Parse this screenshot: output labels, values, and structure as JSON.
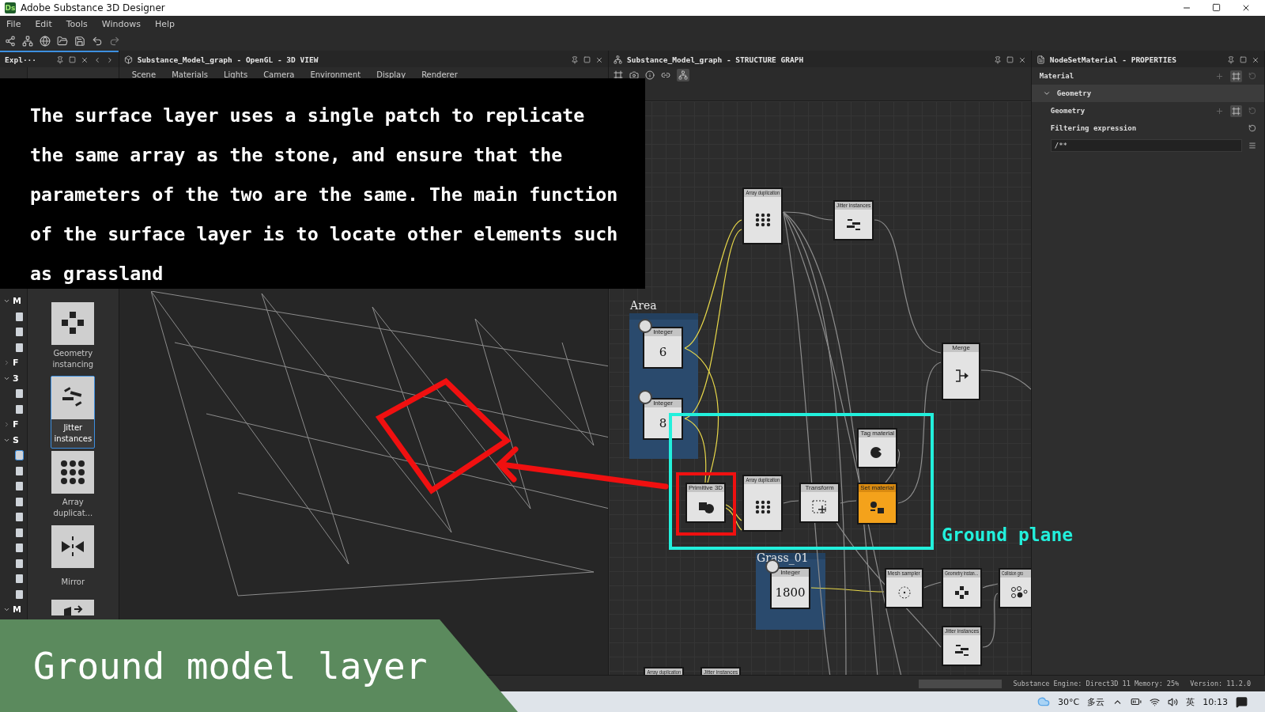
{
  "window": {
    "logo": "Ds",
    "title": "Adobe Substance 3D Designer"
  },
  "menu": [
    "File",
    "Edit",
    "Tools",
    "Windows",
    "Help"
  ],
  "explorer": {
    "tab": "Expl···",
    "tree": [
      {
        "label": "M",
        "expanded": true,
        "children": [
          {
            "selected": false
          },
          {
            "selected": false
          },
          {
            "selected": false
          }
        ]
      },
      {
        "label": "F",
        "expanded": false
      },
      {
        "label": "3",
        "expanded": true,
        "children": [
          {
            "selected": false
          },
          {
            "selected": false
          }
        ]
      },
      {
        "label": "F",
        "expanded": false
      },
      {
        "label": "S",
        "expanded": true,
        "children": [
          {
            "selected": true
          },
          {
            "selected": false
          },
          {
            "selected": false
          },
          {
            "selected": false
          },
          {
            "selected": false
          },
          {
            "selected": false
          },
          {
            "selected": false
          },
          {
            "selected": false
          },
          {
            "selected": false
          },
          {
            "selected": false
          }
        ]
      },
      {
        "label": "M",
        "expanded": true
      }
    ],
    "library": [
      {
        "label": "Geometry instancing",
        "selected": false
      },
      {
        "label": "Jitter instances",
        "selected": true
      },
      {
        "label": "Array duplicat...",
        "selected": false
      },
      {
        "label": "Mirror",
        "selected": false
      },
      {
        "selected": false
      }
    ]
  },
  "view3d": {
    "tab": "Substance_Model_graph - OpenGL - 3D VIEW",
    "menu": [
      "Scene",
      "Materials",
      "Lights",
      "Camera",
      "Environment",
      "Display",
      "Renderer"
    ]
  },
  "graph": {
    "tab": "Substance_Model_graph - STRUCTURE GRAPH",
    "toolbar": [
      {
        "selected": false
      },
      {
        "selected": false
      },
      {
        "selected": false
      },
      {
        "selected": false
      },
      {
        "selected": true
      }
    ],
    "groups": [
      {
        "label": "Area"
      },
      {
        "label": "Grass_01"
      }
    ],
    "nodes": [
      {
        "title": "Array duplication",
        "kind": "array",
        "selected": false
      },
      {
        "title": "Jitter instances",
        "kind": "jitter",
        "selected": false
      },
      {
        "title": "Integer",
        "kind": "integer",
        "value": "6",
        "selected": false
      },
      {
        "title": "Integer",
        "kind": "integer",
        "value": "8",
        "selected": false
      },
      {
        "title": "Merge",
        "kind": "merge",
        "selected": false
      },
      {
        "title": "Primitive 3D",
        "kind": "primitive",
        "selected": false
      },
      {
        "title": "Array duplication",
        "kind": "array",
        "selected": false
      },
      {
        "title": "Transform",
        "kind": "transform",
        "selected": false
      },
      {
        "title": "Tag material",
        "kind": "tag",
        "selected": false
      },
      {
        "title": "Set material",
        "kind": "material",
        "selected": true
      },
      {
        "title": "Integer",
        "kind": "integer",
        "value": "1800",
        "selected": false
      },
      {
        "title": "Mesh sampler",
        "kind": "sampler",
        "selected": false
      },
      {
        "title": "Geometry instan…",
        "kind": "geometry",
        "selected": false
      },
      {
        "title": "Collision gro",
        "kind": "scatter",
        "selected": false
      },
      {
        "title": "Jitter instances",
        "kind": "jitter",
        "selected": false
      },
      {
        "title": "Array duplication",
        "kind": "stub",
        "selected": false
      },
      {
        "title": "Jitter instances",
        "kind": "stub",
        "selected": false
      }
    ]
  },
  "properties": {
    "tab": "NodeSetMaterial - PROPERTIES",
    "material": "Material",
    "section": {
      "label": "Geometry",
      "expanded": true
    },
    "geometry": "Geometry",
    "filter_label": "Filtering expression",
    "filter_value": "/**"
  },
  "status_bar": {
    "engine": "Substance Engine: Direct3D 11 Memory: 25%",
    "version": "Version: 11.2.0"
  },
  "taskbar": {
    "temperature": "30°C",
    "weather": "多云",
    "ime": "英",
    "time": "10:13"
  },
  "overlay": {
    "caption": "The surface layer uses a single patch to replicate the same array as the stone, and ensure that the parameters of the two are the same. The main function of the surface layer is to locate other elements such as grassland",
    "group_label": "Ground plane",
    "banner": "Ground model layer"
  }
}
